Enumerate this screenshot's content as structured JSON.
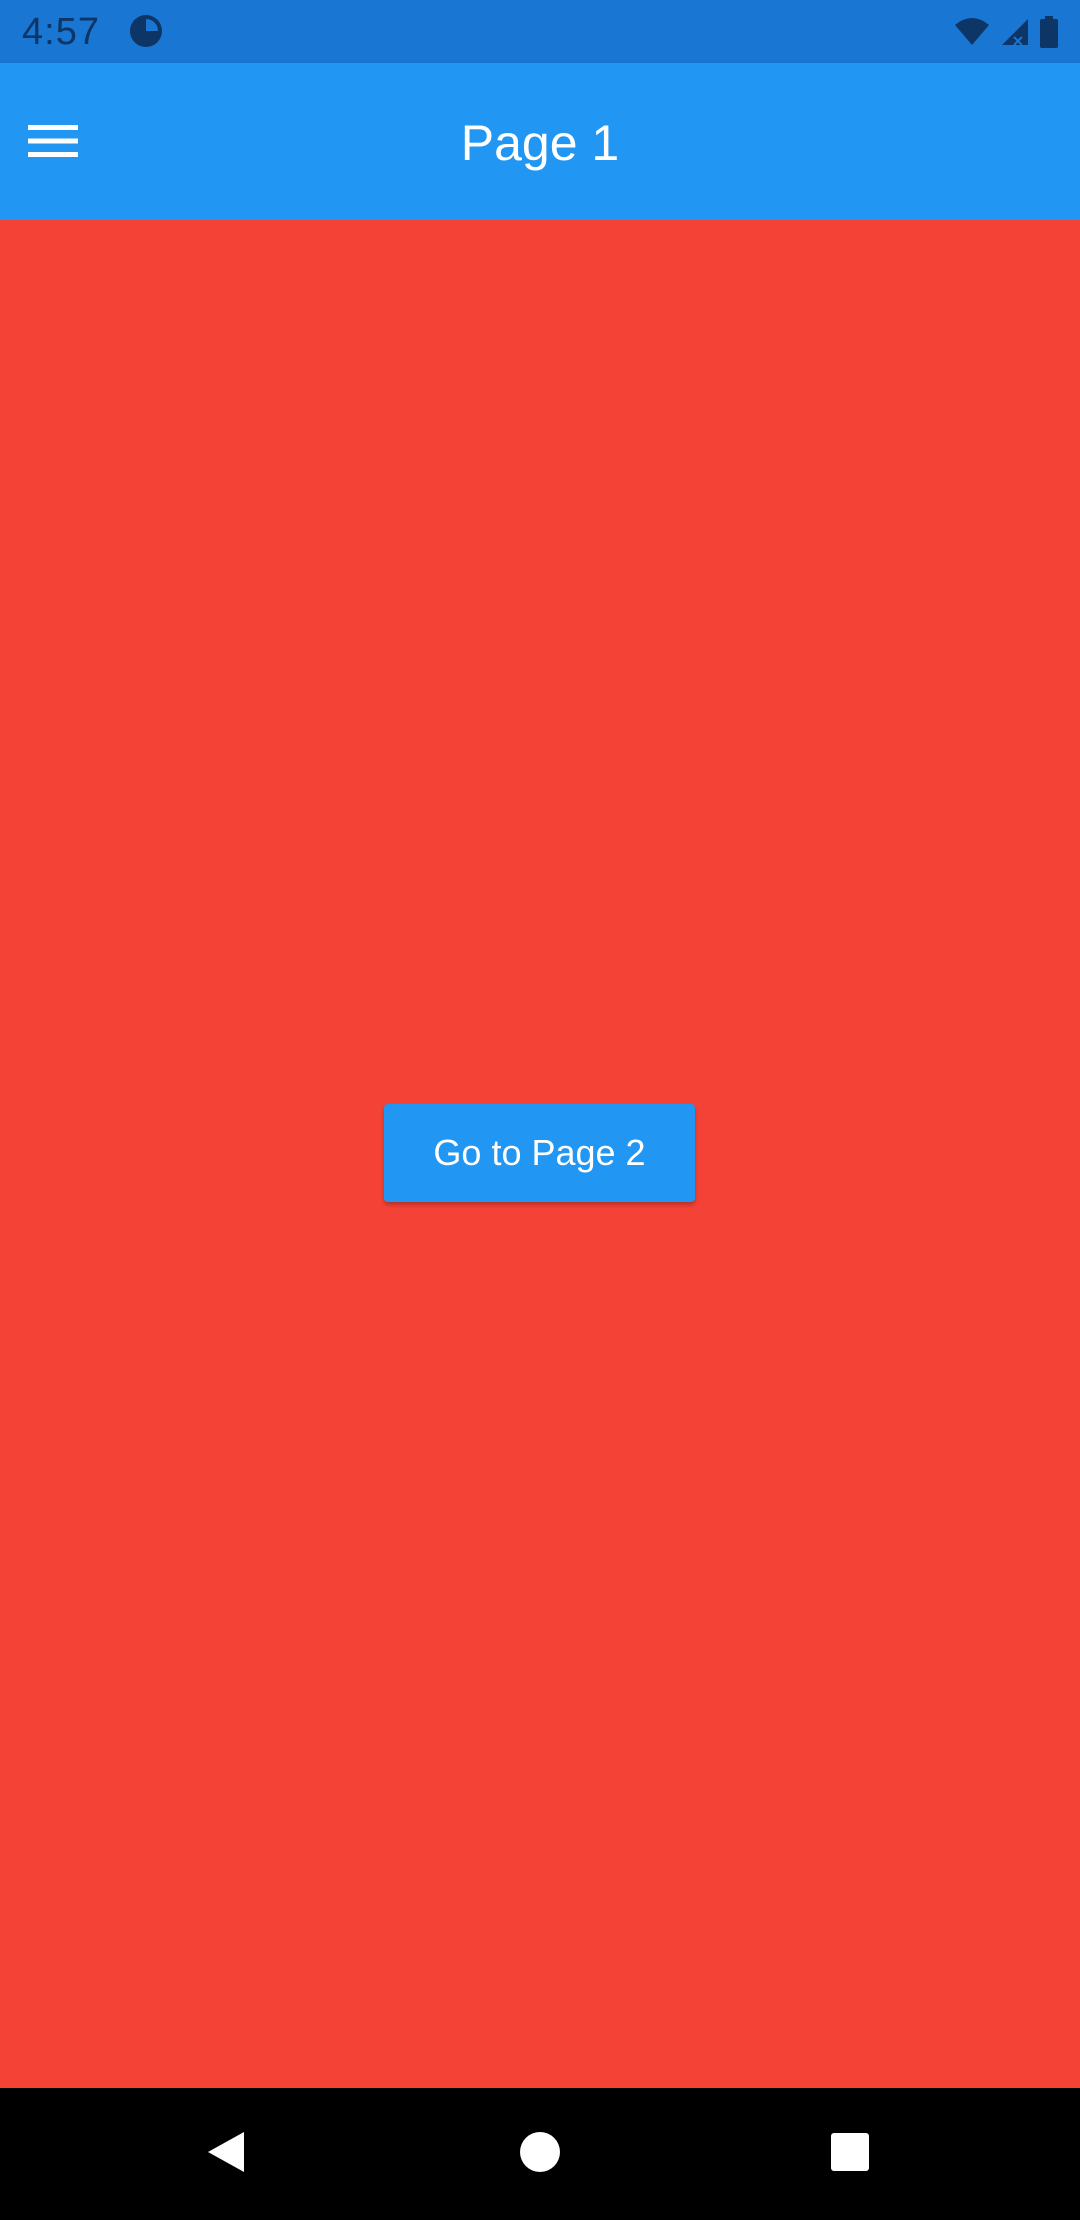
{
  "status_bar": {
    "time": "4:57",
    "icons": [
      "app-notification-icon",
      "wifi-icon",
      "signal-icon",
      "battery-icon"
    ]
  },
  "app_bar": {
    "title": "Page 1",
    "menu_icon": "menu-icon"
  },
  "main": {
    "button_label": "Go to Page 2"
  },
  "nav_bar": {
    "icons": [
      "back-icon",
      "home-icon",
      "recents-icon"
    ]
  },
  "colors": {
    "status_bar": "#1976d2",
    "app_bar": "#2196f3",
    "background": "#f44336",
    "button": "#2196f3",
    "nav_bar": "#000000"
  }
}
